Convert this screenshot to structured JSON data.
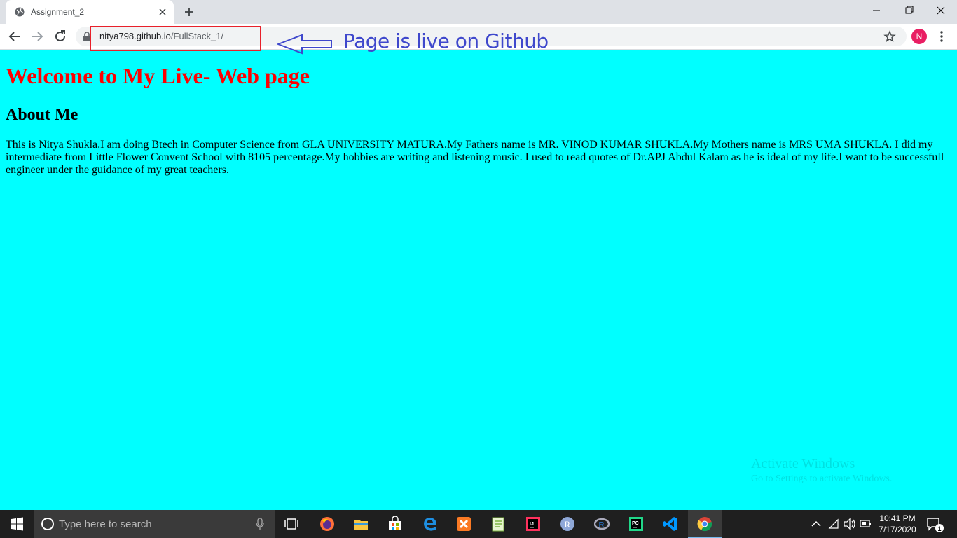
{
  "browser": {
    "tab_title": "Assignment_2",
    "url_host": "nitya798.github.io",
    "url_path": "/FullStack_1/",
    "profile_initial": "N"
  },
  "annotation": {
    "text": "Page is live on Github",
    "highlight_color": "#e8202a",
    "text_color": "#3f48cc"
  },
  "page": {
    "background": "#00ffff",
    "title": "Welcome to My Live- Web page",
    "title_color": "#ff0000",
    "about_heading": "About Me",
    "about_text": "This is Nitya Shukla.I am doing Btech in Computer Science from GLA UNIVERSITY MATURA.My Fathers name is MR. VINOD KUMAR SHUKLA.My Mothers name is MRS UMA SHUKLA. I did my intermediate from Little Flower Convent School with 8105 percentage.My hobbies are writing and listening music. I used to read quotes of Dr.APJ Abdul Kalam as he is ideal of my life.I want to be successfull engineer under the guidance of my great teachers."
  },
  "watermark": {
    "line1": "Activate Windows",
    "line2": "Go to Settings to activate Windows."
  },
  "taskbar": {
    "search_placeholder": "Type here to search",
    "time": "10:41 PM",
    "date": "7/17/2020",
    "notification_count": "1",
    "apps": [
      {
        "name": "task-view-icon"
      },
      {
        "name": "firefox-icon"
      },
      {
        "name": "file-explorer-icon"
      },
      {
        "name": "microsoft-store-icon"
      },
      {
        "name": "edge-icon"
      },
      {
        "name": "xampp-icon"
      },
      {
        "name": "notepad-plus-plus-icon"
      },
      {
        "name": "intellij-idea-icon"
      },
      {
        "name": "r-icon"
      },
      {
        "name": "rstudio-icon"
      },
      {
        "name": "pycharm-icon"
      },
      {
        "name": "vscode-icon"
      },
      {
        "name": "chrome-icon"
      }
    ]
  }
}
